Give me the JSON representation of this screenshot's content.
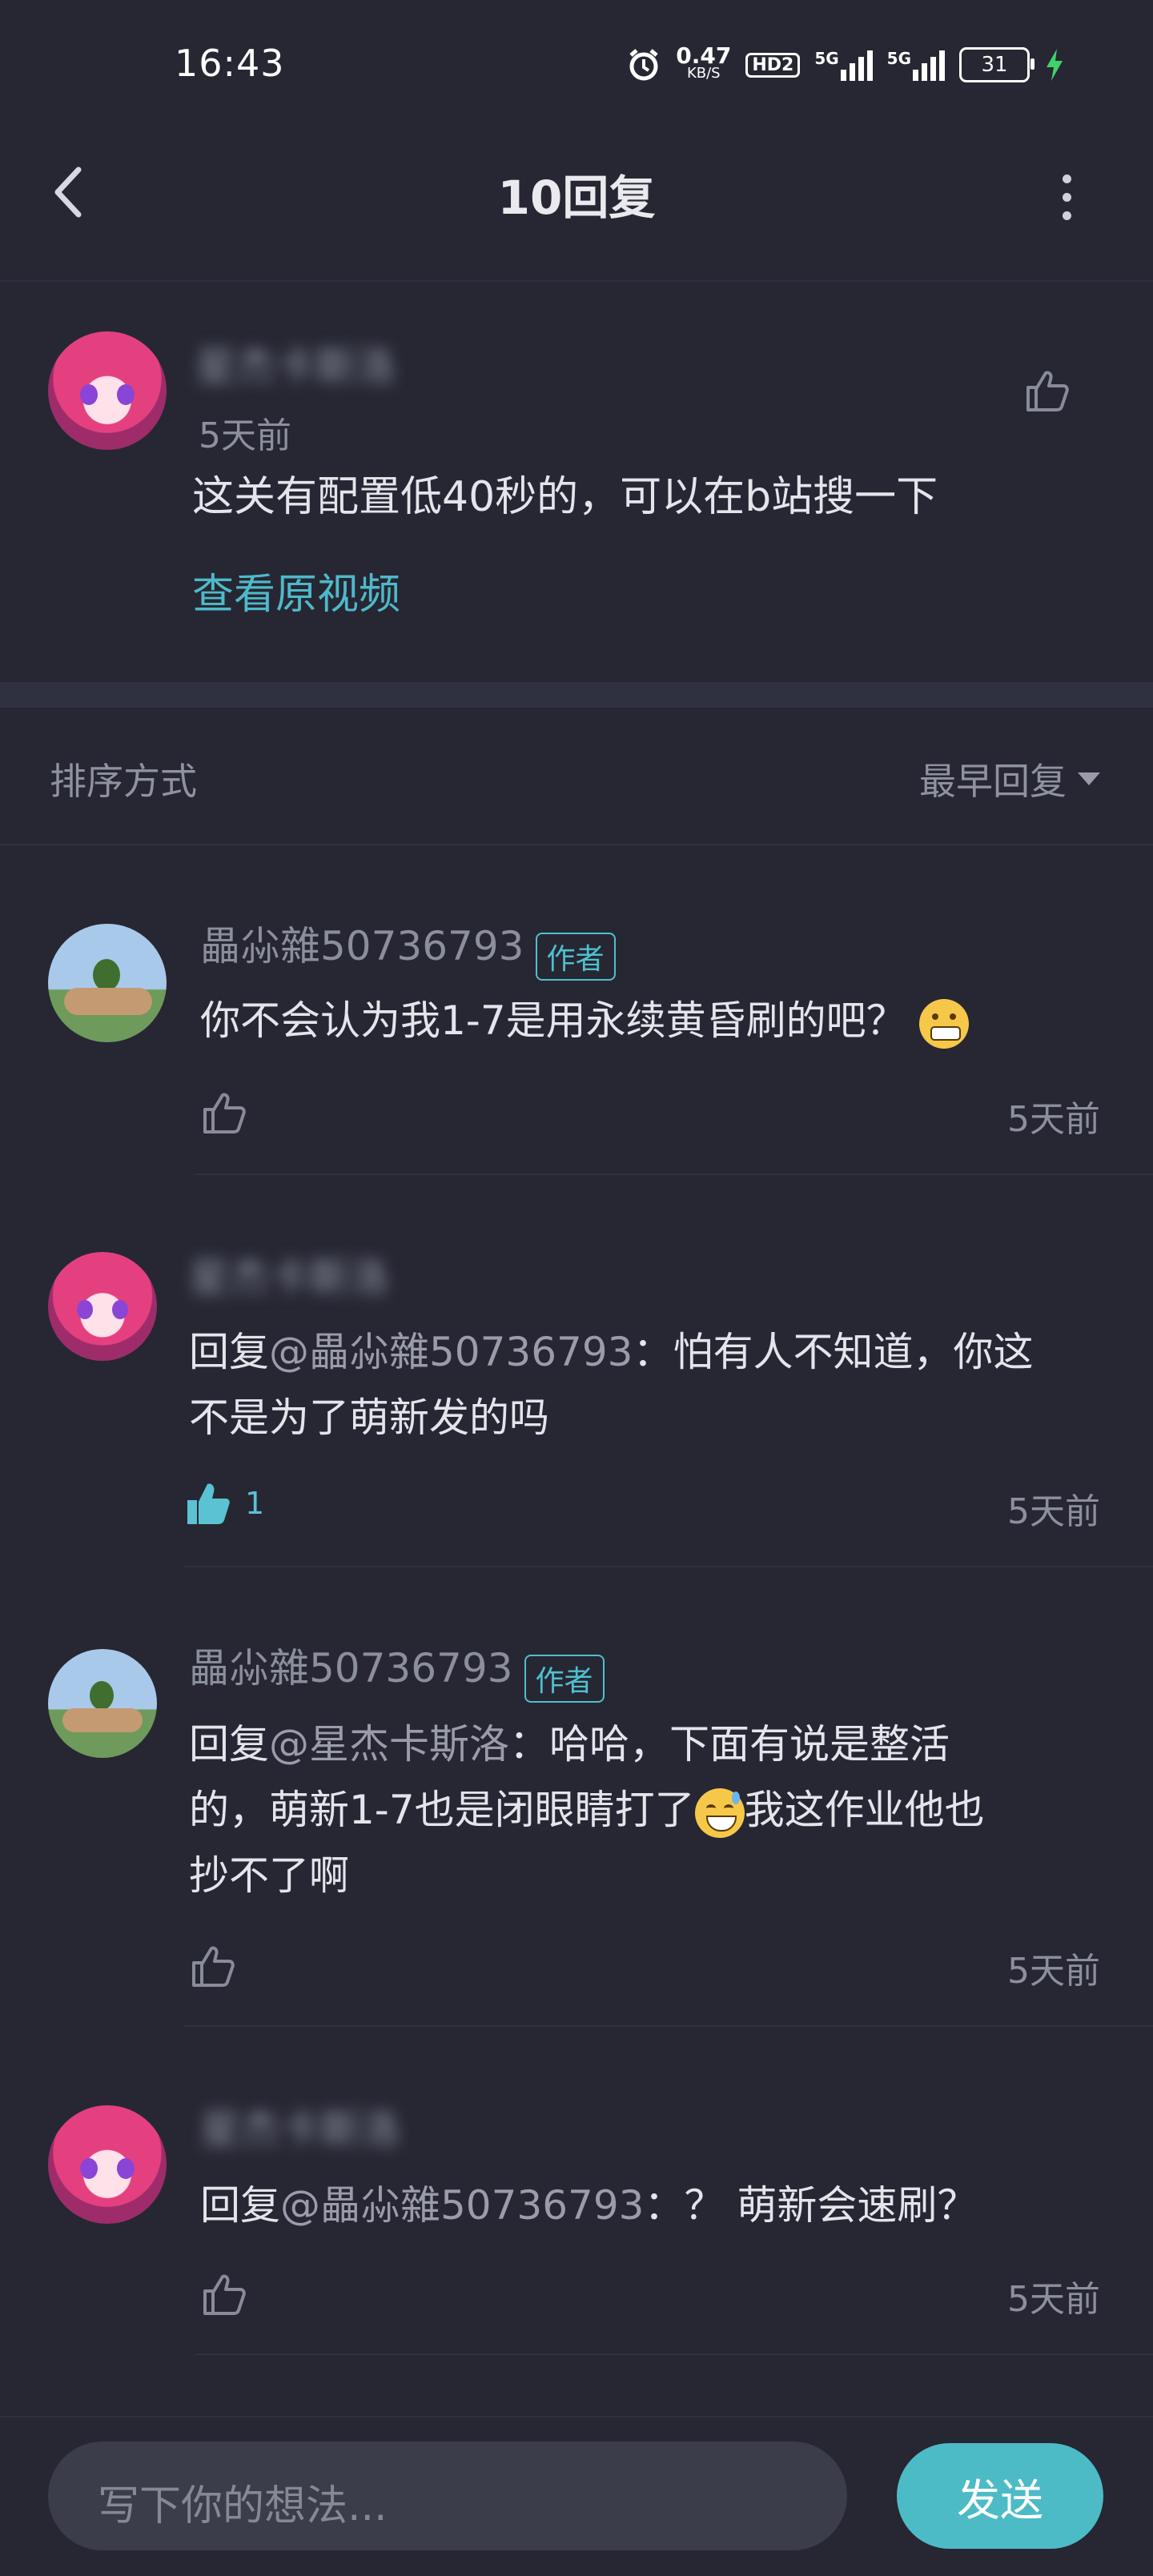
{
  "status_bar": {
    "time": "16:43",
    "net_speed": "0.47",
    "net_unit": "KB/S",
    "hd_label": "HD2",
    "signal1_label": "5G",
    "signal2_label": "5G",
    "battery": "31"
  },
  "header": {
    "title": "10回复"
  },
  "original_comment": {
    "username": "星杰卡斯洛",
    "time": "5天前",
    "text": "这关有配置低40秒的，可以在b站搜一下",
    "view_video_link": "查看原视频"
  },
  "sort": {
    "label": "排序方式",
    "value": "最早回复"
  },
  "replies": [
    {
      "username": "畾尛雜50736793",
      "badge": "作者",
      "text": "你不会认为我1-7是用永续黄昏刷的吧？",
      "likes": "",
      "time": "5天前"
    },
    {
      "username": "星杰卡斯洛",
      "reply_prefix": "回复",
      "mention": "@畾尛雜50736793",
      "text_line1": "：怕有人不知道，你这",
      "text_line2": "不是为了萌新发的吗",
      "likes": "1",
      "time": "5天前"
    },
    {
      "username": "畾尛雜50736793",
      "badge": "作者",
      "reply_prefix": "回复",
      "mention": "@星杰卡斯洛",
      "text_line1": "：哈哈，下面有说是整活",
      "text_line2a": "的，萌新1-7也是闭眼睛打了",
      "text_line2b": "我这作业他也",
      "text_line3": "抄不了啊",
      "time": "5天前"
    },
    {
      "username": "星杰卡斯洛",
      "reply_prefix": "回复",
      "mention": "@畾尛雜50736793",
      "text_line1": "：？ 萌新会速刷？",
      "time": "5天前"
    }
  ],
  "composer": {
    "placeholder": "写下你的想法...",
    "send_label": "发送"
  },
  "colors": {
    "background": "#262733",
    "accent": "#4dbbc5",
    "link": "#4fb9c9"
  }
}
